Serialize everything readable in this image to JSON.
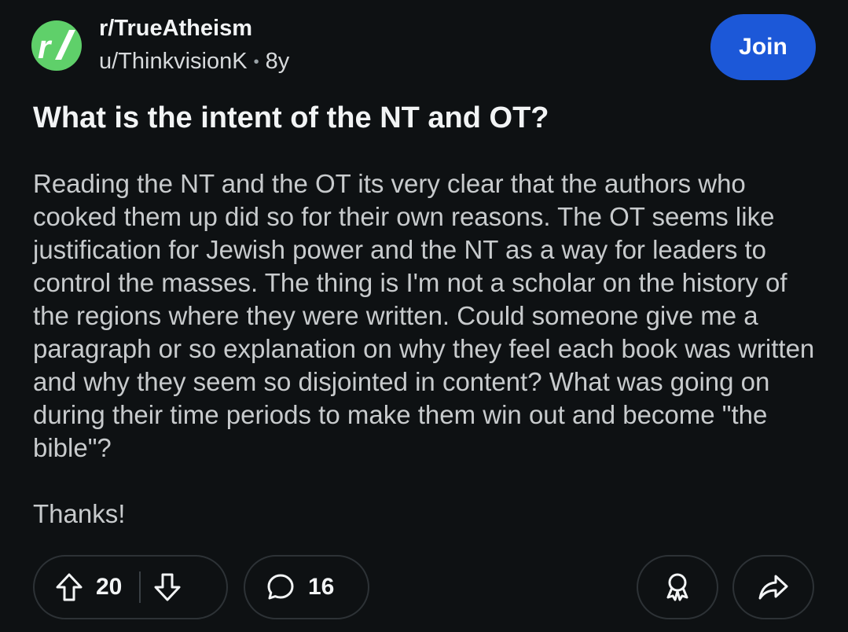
{
  "header": {
    "subreddit": "r/TrueAtheism",
    "username": "u/ThinkvisionK",
    "separator": "•",
    "age": "8y",
    "join_label": "Join",
    "avatar_icon": "subreddit-logo-icon",
    "avatar_color": "#5fd06a",
    "join_color": "#1c58d8"
  },
  "post": {
    "title": "What is the intent of the NT and OT?",
    "body_paragraphs": [
      "Reading the NT and the OT its very clear that the authors who cooked them up did so for their own reasons. The OT seems like justification for Jewish power and the NT as a way for leaders to control the masses. The thing is I'm not a scholar on the history of the regions where they were written. Could someone give me a paragraph or so explanation on why they feel each book was written and why they seem so disjointed in content? What was going on during their time periods to make them win out and become \"the bible\"?",
      "Thanks!"
    ]
  },
  "actions": {
    "upvote_icon": "upvote-arrow-icon",
    "vote_count": "20",
    "downvote_icon": "downvote-arrow-icon",
    "comment_icon": "comment-bubble-icon",
    "comment_count": "16",
    "award_icon": "award-icon",
    "share_icon": "share-arrow-icon"
  }
}
